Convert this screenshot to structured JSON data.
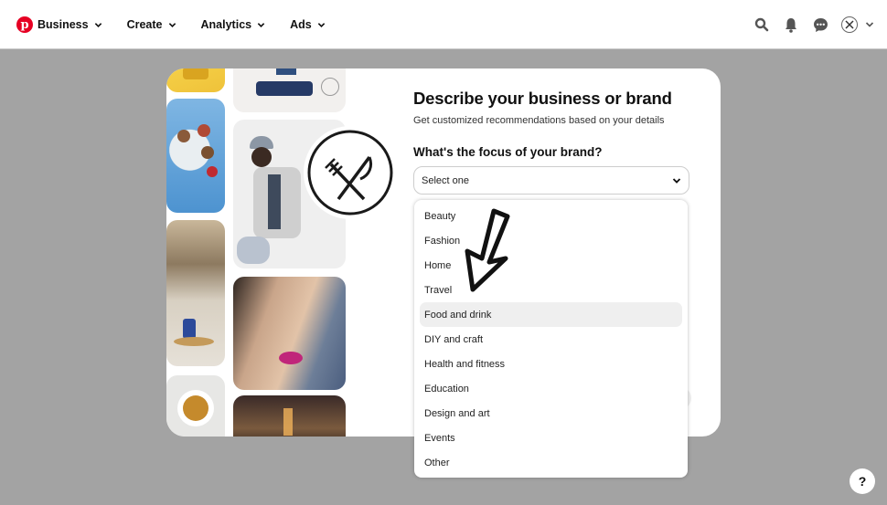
{
  "nav": {
    "logo": "p",
    "items": [
      {
        "label": "Business"
      },
      {
        "label": "Create"
      },
      {
        "label": "Analytics"
      },
      {
        "label": "Ads"
      }
    ],
    "icons": [
      "search-icon",
      "notifications-bell-icon",
      "messages-icon",
      "account-avatar"
    ]
  },
  "modal": {
    "title": "Describe your business or brand",
    "subtitle": "Get customized recommendations based on your details",
    "question": "What's the focus of your brand?",
    "select_value": "Select one",
    "collage_images": [
      "yellow-dinosaur-toy",
      "living-room-sofa",
      "food-platter",
      "man-in-jacket",
      "kids-bunk-bed",
      "woman-portrait",
      "bowl-of-food",
      "city-street-lights"
    ],
    "profile_badge": "fork-and-knife-logo"
  },
  "dropdown": {
    "highlighted": "Food and drink",
    "options": [
      {
        "label": "Beauty"
      },
      {
        "label": "Fashion"
      },
      {
        "label": "Home"
      },
      {
        "label": "Travel"
      },
      {
        "label": "Food and drink"
      },
      {
        "label": "DIY and craft"
      },
      {
        "label": "Health and fitness"
      },
      {
        "label": "Education"
      },
      {
        "label": "Design and art"
      },
      {
        "label": "Events"
      },
      {
        "label": "Other"
      }
    ]
  },
  "help": {
    "label": "?"
  },
  "colors": {
    "brand": "#e60023",
    "overlay": "#a3a3a3",
    "highlight": "#efefef"
  }
}
